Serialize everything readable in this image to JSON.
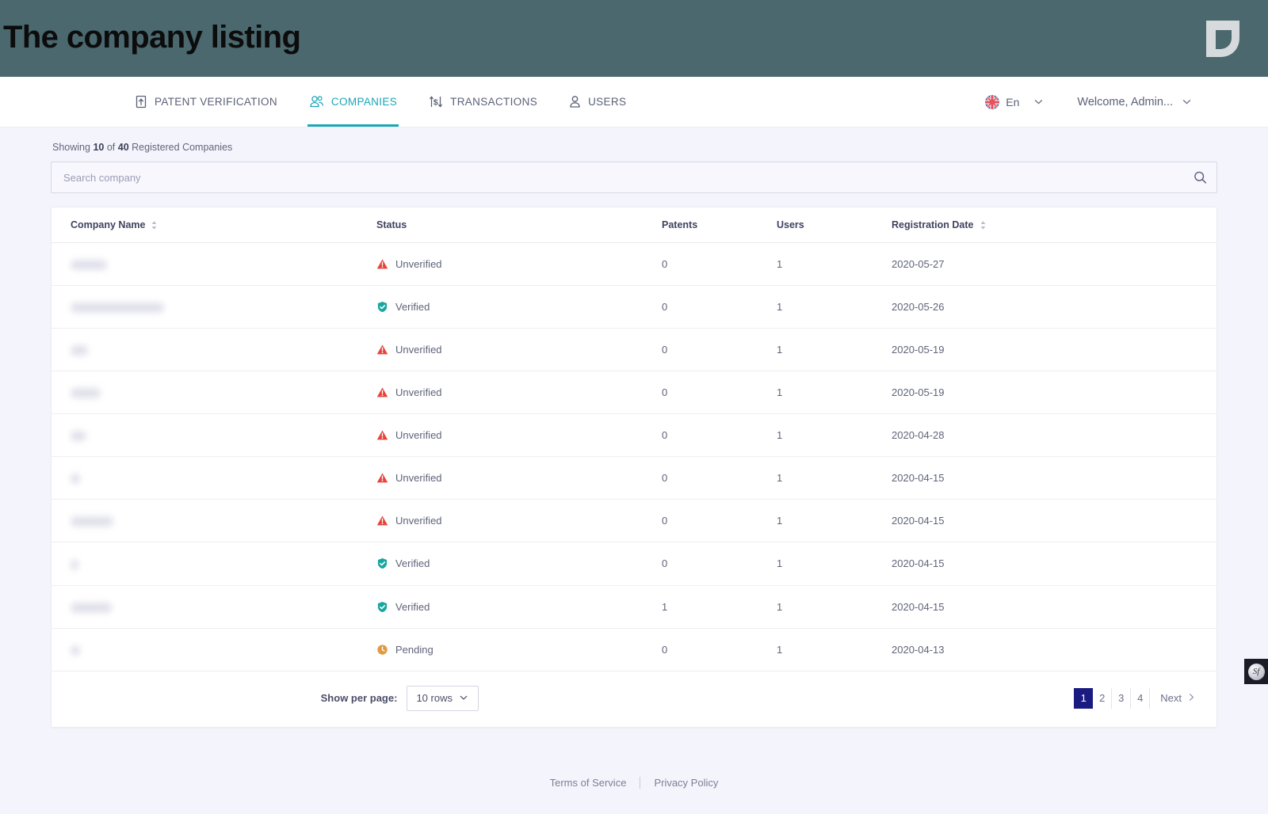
{
  "banner": {
    "title": "The company listing",
    "logo_icon": "leaf-logo",
    "bg_color": "#4a686e"
  },
  "nav": {
    "tabs": [
      {
        "label": "PATENT VERIFICATION",
        "icon": "document-upload-icon",
        "active": false
      },
      {
        "label": "COMPANIES",
        "icon": "group-people-icon",
        "active": true
      },
      {
        "label": "TRANSACTIONS",
        "icon": "transfer-dollar-icon",
        "active": false
      },
      {
        "label": "USERS",
        "icon": "person-icon",
        "active": false
      }
    ],
    "active_color": "#1aa6b7",
    "language": {
      "label": "En",
      "icon": "uk-flag-icon",
      "chevron": "chevron-down-icon"
    },
    "user": {
      "label": "Welcome, Admin...",
      "chevron": "chevron-down-icon"
    }
  },
  "summary": {
    "prefix": "Showing",
    "shown": "10",
    "middle": "of",
    "total": "40",
    "suffix": "Registered Companies"
  },
  "search": {
    "placeholder": "Search company",
    "value": "",
    "icon": "search-icon"
  },
  "table": {
    "columns": [
      {
        "label": "Company Name",
        "sortable": true
      },
      {
        "label": "Status",
        "sortable": false
      },
      {
        "label": "Patents",
        "sortable": false
      },
      {
        "label": "Users",
        "sortable": false
      },
      {
        "label": "Registration Date",
        "sortable": true
      }
    ],
    "rows": [
      {
        "name": "",
        "redacted_width": 46,
        "status": "Unverified",
        "status_icon": "warning-triangle-icon",
        "patents": "0",
        "users": "1",
        "date": "2020-05-27"
      },
      {
        "name": "",
        "redacted_width": 118,
        "status": "Verified",
        "status_icon": "shield-check-icon",
        "patents": "0",
        "users": "1",
        "date": "2020-05-26"
      },
      {
        "name": "",
        "redacted_width": 22,
        "status": "Unverified",
        "status_icon": "warning-triangle-icon",
        "patents": "0",
        "users": "1",
        "date": "2020-05-19"
      },
      {
        "name": "",
        "redacted_width": 38,
        "status": "Unverified",
        "status_icon": "warning-triangle-icon",
        "patents": "0",
        "users": "1",
        "date": "2020-05-19"
      },
      {
        "name": "",
        "redacted_width": 20,
        "status": "Unverified",
        "status_icon": "warning-triangle-icon",
        "patents": "0",
        "users": "1",
        "date": "2020-04-28"
      },
      {
        "name": "",
        "redacted_width": 12,
        "status": "Unverified",
        "status_icon": "warning-triangle-icon",
        "patents": "0",
        "users": "1",
        "date": "2020-04-15"
      },
      {
        "name": "",
        "redacted_width": 54,
        "status": "Unverified",
        "status_icon": "warning-triangle-icon",
        "patents": "0",
        "users": "1",
        "date": "2020-04-15"
      },
      {
        "name": "",
        "redacted_width": 10,
        "status": "Verified",
        "status_icon": "shield-check-icon",
        "patents": "0",
        "users": "1",
        "date": "2020-04-15"
      },
      {
        "name": "",
        "redacted_width": 52,
        "status": "Verified",
        "status_icon": "shield-check-icon",
        "patents": "1",
        "users": "1",
        "date": "2020-04-15"
      },
      {
        "name": "",
        "redacted_width": 12,
        "status": "Pending",
        "status_icon": "clock-icon",
        "patents": "0",
        "users": "1",
        "date": "2020-04-13"
      }
    ],
    "status_colors": {
      "Unverified": "#e8433a",
      "Verified": "#1aa6a0",
      "Pending": "#e29a42"
    }
  },
  "pagination": {
    "per_page_label": "Show per page:",
    "per_page_value": "10 rows",
    "per_page_chevron": "chevron-down-icon",
    "pages": [
      "1",
      "2",
      "3",
      "4"
    ],
    "active_page": "1",
    "next_label": "Next",
    "next_icon": "chevron-right-icon",
    "active_bg": "#1a1a80"
  },
  "footer": {
    "terms": "Terms of Service",
    "privacy": "Privacy Policy"
  },
  "side_badge": {
    "label": "Sf",
    "name": "sf-widget-badge"
  }
}
